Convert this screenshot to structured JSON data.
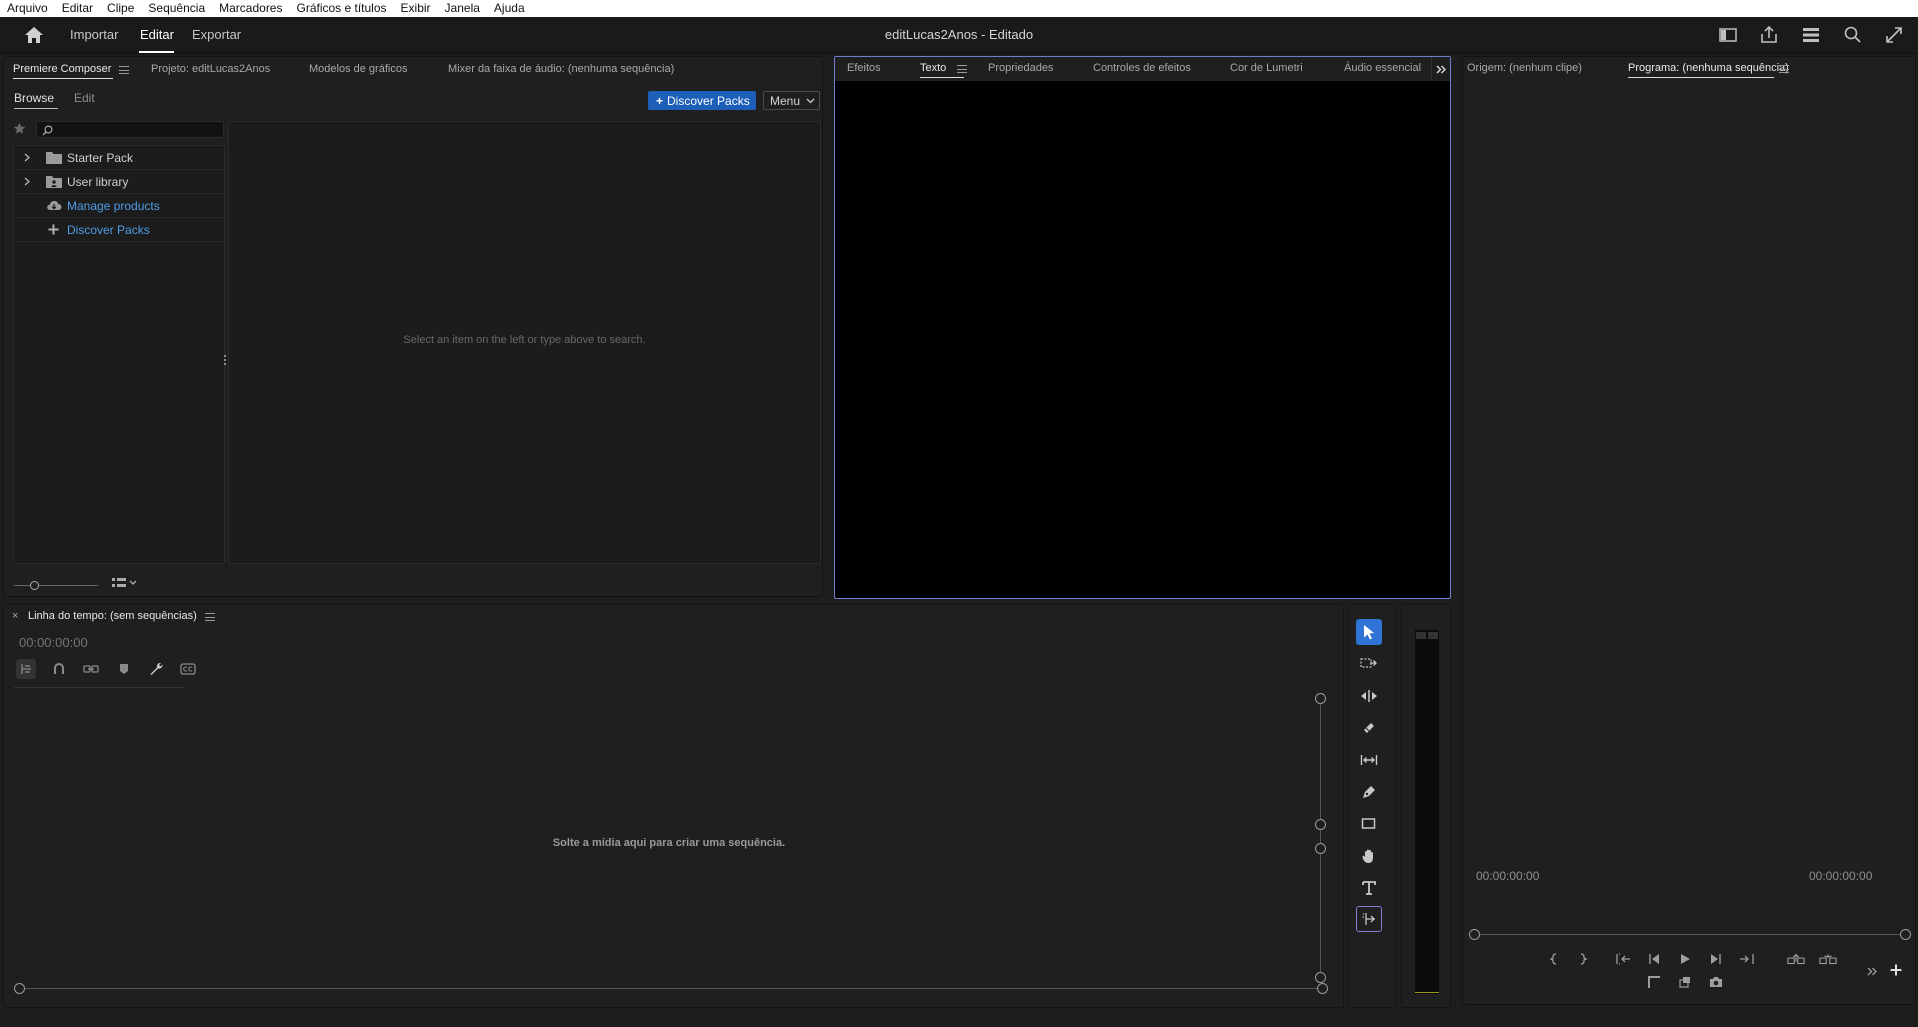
{
  "menu": [
    "Arquivo",
    "Editar",
    "Clipe",
    "Sequência",
    "Marcadores",
    "Gráficos e títulos",
    "Exibir",
    "Janela",
    "Ajuda"
  ],
  "header": {
    "tabs": [
      "Importar",
      "Editar",
      "Exportar"
    ],
    "active_tab": "Editar",
    "title": "editLucas2Anos - Editado"
  },
  "left_panel": {
    "tabs": [
      "Premiere Composer",
      "Projeto: editLucas2Anos",
      "Modelos de gráficos",
      "Mixer da faixa de áudio: (nenhuma sequência)"
    ],
    "subtabs": [
      "Browse",
      "Edit"
    ],
    "discover_button": "Discover Packs",
    "menu_button": "Menu",
    "search_placeholder": "",
    "tree": [
      "Starter Pack",
      "User library",
      "Manage products",
      "Discover Packs"
    ],
    "empty_message": "Select an item on the left or type above to search."
  },
  "effects_panel": {
    "tabs": [
      "Efeitos",
      "Texto",
      "Propriedades",
      "Controles de efeitos",
      "Cor de Lumetri",
      "Áudio essencial"
    ],
    "active_tab": "Texto"
  },
  "program_panel": {
    "tabs": [
      "Origem: (nenhum clipe)",
      "Programa: (nenhuma sequência)"
    ],
    "timecode_left": "00:00:00:00",
    "timecode_right": "00:00:00:00"
  },
  "timeline": {
    "title": "Linha do tempo: (sem sequências)",
    "timecode": "00:00:00:00",
    "drop_message": "Solte a mídia aqui para criar uma sequência."
  },
  "colors": {
    "accent": "#2f74d4",
    "link": "#4f9ce8",
    "panel_focus_border": "#6b7fd1"
  }
}
